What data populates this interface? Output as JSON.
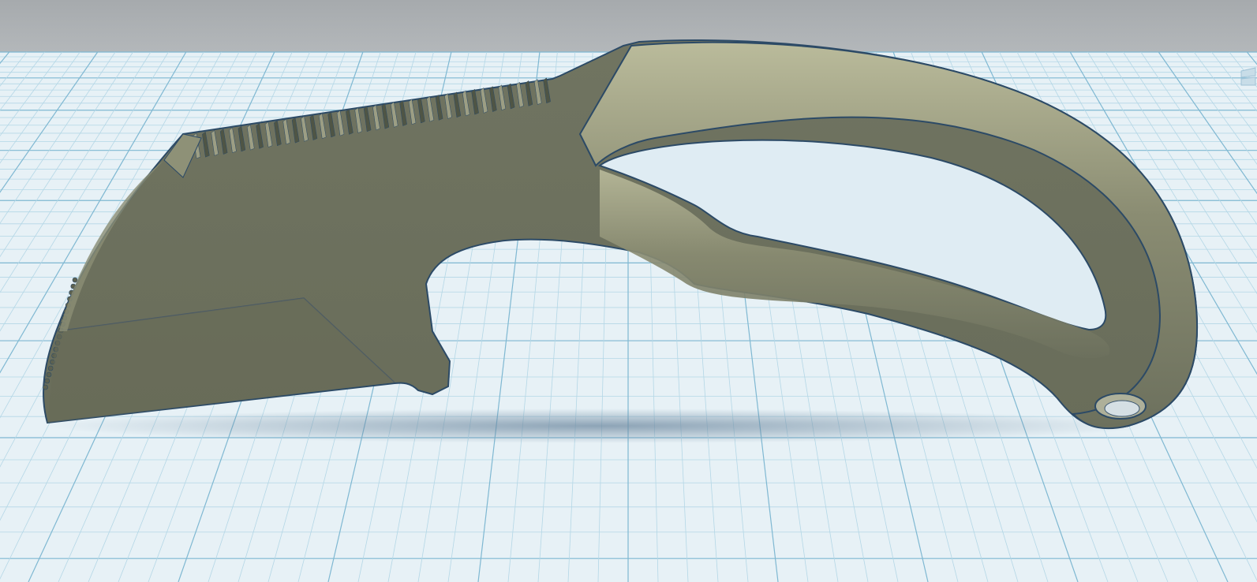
{
  "scene": {
    "background_color": "#a9adb0",
    "workplane_color": "#e6f0f5",
    "grid_minor_color": "#b4d7e6",
    "grid_major_color": "#7fb8d2",
    "model": {
      "name": "karambit-knife-model",
      "face_color": "#6f7361",
      "highlight_color": "#b9b99a",
      "outline_color": "#2c4a66",
      "shadow_color": "#7b95ab"
    }
  },
  "view_cube": {
    "icon": "view-cube-icon"
  }
}
